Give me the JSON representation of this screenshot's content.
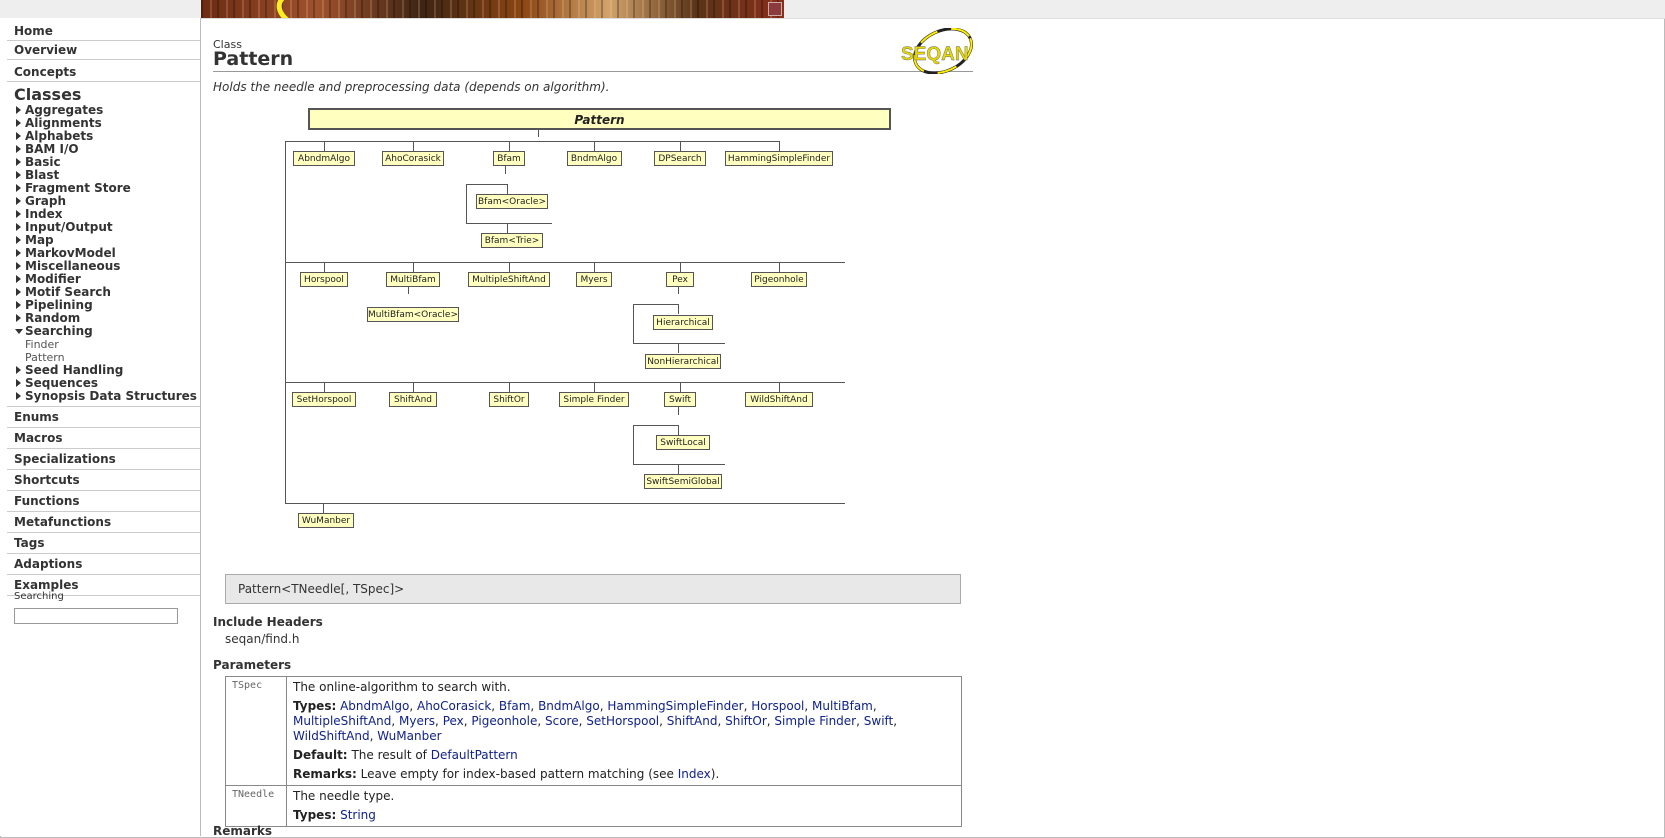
{
  "nav": {
    "home": "Home",
    "overview": "Overview",
    "concepts": "Concepts",
    "classes": "Classes",
    "class_groups": [
      "Aggregates",
      "Alignments",
      "Alphabets",
      "BAM I/O",
      "Basic",
      "Blast",
      "Fragment Store",
      "Graph",
      "Index",
      "Input/Output",
      "Map",
      "MarkovModel",
      "Miscellaneous",
      "Modifier",
      "Motif Search",
      "Pipelining",
      "Random"
    ],
    "open_group": "Searching",
    "open_group_children": [
      "Finder",
      "Pattern"
    ],
    "class_groups_after": [
      "Seed Handling",
      "Sequences",
      "Synopsis Data Structures"
    ],
    "bottom": [
      "Enums",
      "Macros",
      "Specializations",
      "Shortcuts",
      "Functions",
      "Metafunctions",
      "Tags",
      "Adaptions",
      "Examples"
    ],
    "search_label": "Searching",
    "search_value": ""
  },
  "page": {
    "kind": "Class",
    "title": "Pattern",
    "brief": "Holds the needle and preprocessing data (depends on algorithm).",
    "logo_text": "SEQAN"
  },
  "diagram": {
    "root": "Pattern",
    "row1": [
      "AbndmAlgo",
      "AhoCorasick",
      "Bfam",
      "BndmAlgo",
      "DPSearch",
      "HammingSimpleFinder"
    ],
    "bfam_children": [
      "Bfam<Oracle>",
      "Bfam<Trie>"
    ],
    "row2": [
      "Horspool",
      "MultiBfam",
      "MultipleShiftAnd",
      "Myers",
      "Pex",
      "Pigeonhole"
    ],
    "multibfam_child": "MultiBfam<Oracle>",
    "pex_children": [
      "Hierarchical",
      "NonHierarchical"
    ],
    "row3": [
      "SetHorspool",
      "ShiftAnd",
      "ShiftOr",
      "Simple Finder",
      "Swift",
      "WildShiftAnd"
    ],
    "swift_children": [
      "SwiftLocal",
      "SwiftSemiGlobal"
    ],
    "row4": [
      "WuManber"
    ]
  },
  "signature": "Pattern<TNeedle[, TSpec]>",
  "include": {
    "heading": "Include Headers",
    "file": "seqan/find.h"
  },
  "params": {
    "heading": "Parameters",
    "tspec": {
      "name": "TSpec",
      "desc": "The online-algorithm to search with.",
      "types_label": "Types:",
      "types": [
        "AbndmAlgo",
        "AhoCorasick",
        "Bfam",
        "BndmAlgo",
        "HammingSimpleFinder",
        "Horspool",
        "MultiBfam",
        "MultipleShiftAnd",
        "Myers",
        "Pex",
        "Pigeonhole",
        "Score",
        "SetHorspool",
        "ShiftAnd",
        "ShiftOr",
        "Simple Finder",
        "Swift",
        "WildShiftAnd",
        "WuManber"
      ],
      "default_label": "Default:",
      "default_text": "The result of",
      "default_link": "DefaultPattern",
      "remarks_label": "Remarks:",
      "remarks_text": "Leave empty for index-based pattern matching (see",
      "remarks_link": "Index",
      "remarks_end": ")."
    },
    "tneedle": {
      "name": "TNeedle",
      "desc": "The needle type.",
      "types_label": "Types:",
      "types": [
        "String"
      ]
    }
  },
  "remarks_heading": "Remarks"
}
